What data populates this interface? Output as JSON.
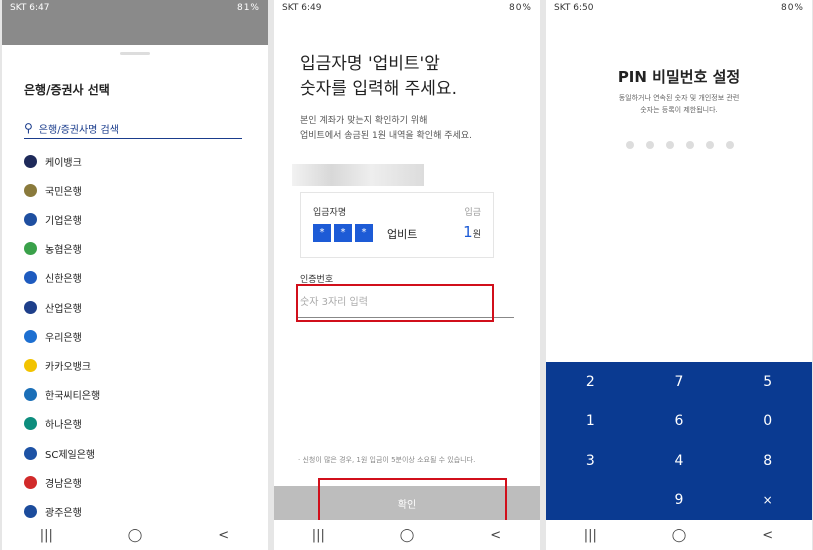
{
  "screen1": {
    "status": {
      "left": "SKT 6:47",
      "right": "81%"
    },
    "title": "은행/증권사 선택",
    "search": {
      "placeholder": "은행/증권사명 검색"
    },
    "banks": [
      {
        "name": "케이뱅크",
        "color": "#1e2a5a"
      },
      {
        "name": "국민은행",
        "color": "#8a7a3c"
      },
      {
        "name": "기업은행",
        "color": "#1f4fa0"
      },
      {
        "name": "농협은행",
        "color": "#3aa14a"
      },
      {
        "name": "신한은행",
        "color": "#1e5bbf"
      },
      {
        "name": "산업은행",
        "color": "#1e3f8a"
      },
      {
        "name": "우리은행",
        "color": "#1d6fd1"
      },
      {
        "name": "카카오뱅크",
        "color": "#f2c300"
      },
      {
        "name": "한국씨티은행",
        "color": "#1b6fb8"
      },
      {
        "name": "하나은행",
        "color": "#0d8d7d"
      },
      {
        "name": "SC제일은행",
        "color": "#1d52a5"
      },
      {
        "name": "경남은행",
        "color": "#d12a2a"
      },
      {
        "name": "광주은행",
        "color": "#1c4c9c"
      }
    ]
  },
  "screen2": {
    "status": {
      "left": "SKT 6:49",
      "right": "80%"
    },
    "heading_line1": "입금자명 '업비트'앞",
    "heading_line2": "숫자를 입력해 주세요.",
    "sub_line1": "본인 계좌가 맞는지 확인하기 위해",
    "sub_line2": "업비트에서 송금된 1원 내역을 확인해 주세요.",
    "card": {
      "depositor_label": "입금자명",
      "deposit_label": "입금",
      "stars": [
        "*",
        "*",
        "*"
      ],
      "name": "업비트",
      "amount": "1",
      "unit": "원"
    },
    "field_label": "인증번호",
    "field_placeholder": "숫자 3자리 입력",
    "note": "· 신청이 많은 경우, 1원 입금이 5분이상 소요될 수 있습니다.",
    "confirm_label": "확인"
  },
  "screen3": {
    "status": {
      "left": "SKT 6:50",
      "right": "80%"
    },
    "title": "PIN 비밀번호 설정",
    "desc_line1": "동일하거나 연속된 숫자 및 개인정보 관련",
    "desc_line2": "숫자는 등록이 제한됩니다.",
    "pin_length": 6,
    "keys": [
      "2",
      "7",
      "5",
      "1",
      "6",
      "0",
      "3",
      "4",
      "8",
      "",
      "9",
      "×"
    ]
  },
  "navbar": {
    "recent": "|||",
    "home": "◯",
    "back": "<"
  }
}
